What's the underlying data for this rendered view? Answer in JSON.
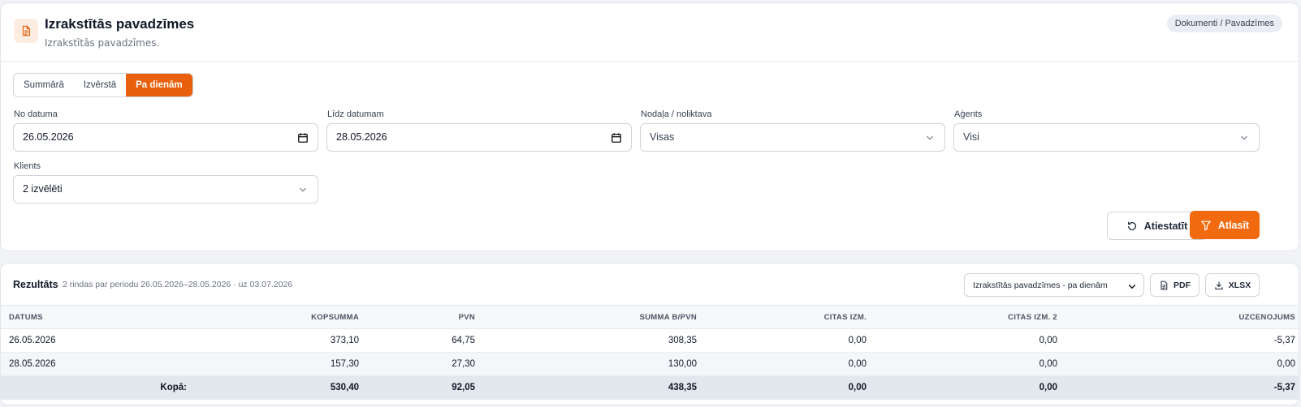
{
  "header": {
    "title": "Izrakstītās pavadzīmes",
    "subtitle": "Izrakstītās pavadzīmes.",
    "breadcrumb": "Dokumenti / Pavadzīmes",
    "icon": "document-icon"
  },
  "tabs": [
    {
      "label": "Summārā",
      "active": false
    },
    {
      "label": "Izvērstā",
      "active": false
    },
    {
      "label": "Pa dienām",
      "active": true
    }
  ],
  "filters": {
    "from_date": {
      "label": "No datuma",
      "value": "26.05.2026"
    },
    "to_date": {
      "label": "Līdz datumam",
      "value": "28.05.2026"
    },
    "department": {
      "label": "Nodaļa / noliktava",
      "value": "Visas"
    },
    "agent": {
      "label": "Aģents",
      "value": "Visi"
    },
    "client": {
      "label": "Klients",
      "value": "2 izvēlēti"
    }
  },
  "actions": {
    "reset_label": "Atiestatīt",
    "apply_label": "Atlasīt"
  },
  "results": {
    "title": "Rezultāts",
    "meta": "2 rindas par periodu 26.05.2026–28.05.2026 · uz 03.07.2026",
    "report_select": "Izrakstītās pavadzīmes - pa dienām",
    "pdf_label": "PDF",
    "xlsx_label": "XLSX",
    "columns": [
      "DATUMS",
      "KOPSUMMA",
      "PVN",
      "SUMMA B/PVN",
      "CITAS IZM.",
      "CITAS IZM. 2",
      "UZCENOJUMS"
    ],
    "rows": [
      [
        "26.05.2026",
        "373,10",
        "64,75",
        "308,35",
        "0,00",
        "0,00",
        "-5,37"
      ],
      [
        "28.05.2026",
        "157,30",
        "27,30",
        "130,00",
        "0,00",
        "0,00",
        "0,00"
      ]
    ],
    "total": [
      "Kopā:",
      "530,40",
      "92,05",
      "438,35",
      "0,00",
      "0,00",
      "-5,37"
    ]
  },
  "colors": {
    "accent": "#f26a0f",
    "tab_active": "#ea5f0b",
    "icon_bg": "#fdece2"
  }
}
